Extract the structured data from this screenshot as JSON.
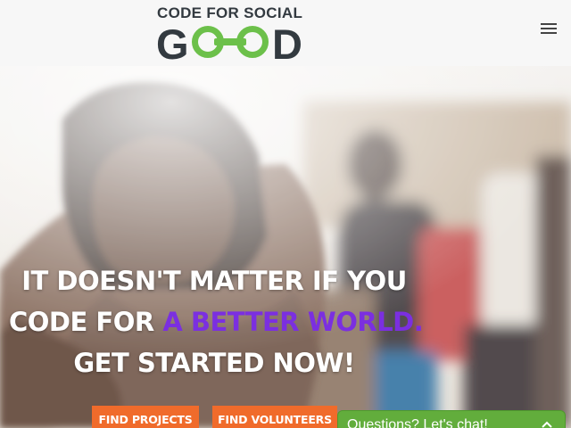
{
  "header": {
    "logo_top": "CODE FOR SOCIAL",
    "logo_bottom_letters": [
      "G",
      "D"
    ],
    "menu_icon": "hamburger-icon"
  },
  "hero": {
    "line1": "IT DOESN'T MATTER IF YOU",
    "line2_prefix": "CODE FOR ",
    "line2_accent": "A BETTER WORLD.",
    "line3": "GET STARTED NOW!",
    "accent_color": "#7b2fe0",
    "buttons": {
      "find_projects": "FIND PROJECTS",
      "find_volunteers": "FIND VOLUNTEERS"
    },
    "button_color": "#f06b2b"
  },
  "chat": {
    "label": "Questions? Let's chat!",
    "color": "#62ad3c",
    "icon": "chevron-up-icon"
  }
}
